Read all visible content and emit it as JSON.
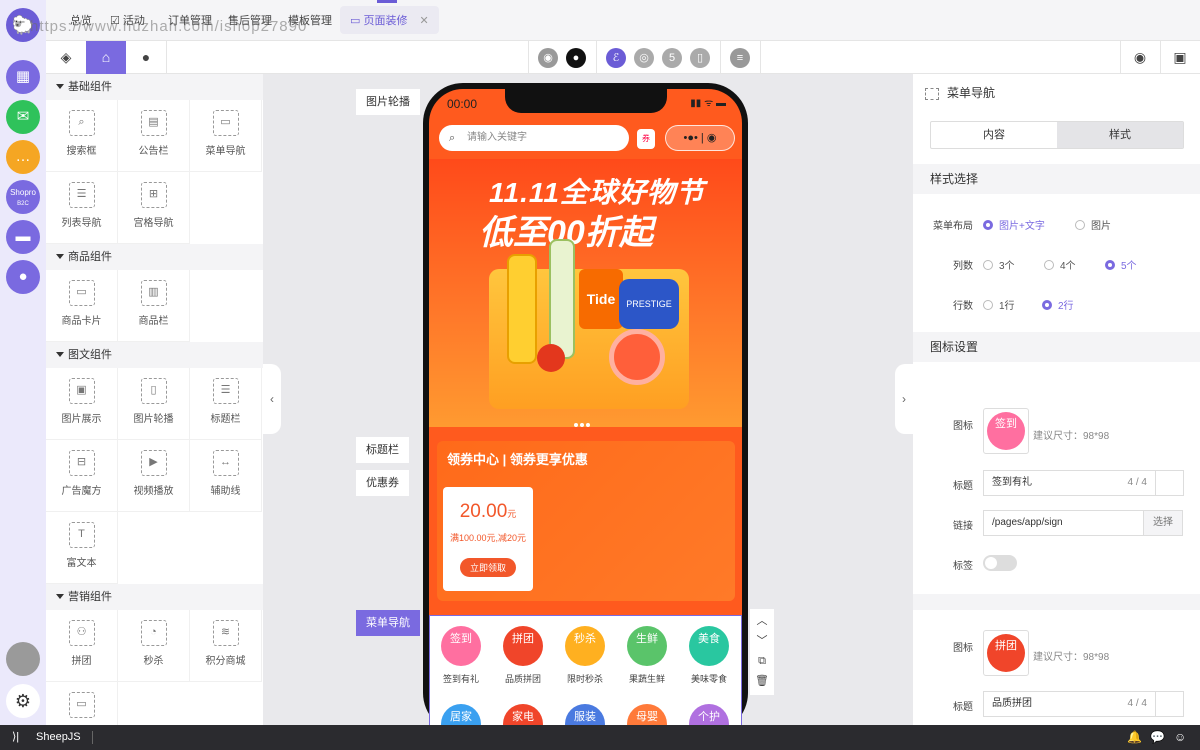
{
  "watermark": "https://www.huzhan.com/ishop27890",
  "topnav": {
    "tabs": [
      {
        "label": "总览"
      },
      {
        "label": "活动"
      },
      {
        "label": "订单管理"
      },
      {
        "label": "售后管理"
      },
      {
        "label": "模板管理"
      },
      {
        "label": "页面装修"
      }
    ],
    "close": "✕"
  },
  "rail": {
    "logo": "🐑",
    "items": [
      {
        "icon": "apps-icon",
        "glyph": "▦",
        "color": "#7a6ae0"
      },
      {
        "icon": "wechat-icon",
        "glyph": "✉",
        "color": "#2fc25b"
      },
      {
        "icon": "chat-icon",
        "glyph": "…",
        "color": "#f5a623"
      },
      {
        "icon": "shopro-icon",
        "glyph": "Shopro",
        "color": "#7a6ae0"
      },
      {
        "icon": "folder-icon",
        "glyph": "▬",
        "color": "#7a6ae0"
      },
      {
        "icon": "user-icon",
        "glyph": "●",
        "color": "#7a6ae0"
      }
    ],
    "shopro_sub": "B2C"
  },
  "left_panel": {
    "groups": [
      {
        "title": "基础组件",
        "items": [
          {
            "label": "搜索框",
            "glyph": "⌕"
          },
          {
            "label": "公告栏",
            "glyph": "▤"
          },
          {
            "label": "菜单导航",
            "glyph": "▭"
          },
          {
            "label": "列表导航",
            "glyph": "☰"
          },
          {
            "label": "宫格导航",
            "glyph": "⊞"
          }
        ]
      },
      {
        "title": "商品组件",
        "items": [
          {
            "label": "商品卡片",
            "glyph": "▭"
          },
          {
            "label": "商品栏",
            "glyph": "▥"
          }
        ]
      },
      {
        "title": "图文组件",
        "items": [
          {
            "label": "图片展示",
            "glyph": "▣"
          },
          {
            "label": "图片轮播",
            "glyph": "▯"
          },
          {
            "label": "标题栏",
            "glyph": "☰"
          },
          {
            "label": "广告魔方",
            "glyph": "⊟"
          },
          {
            "label": "视频播放",
            "glyph": "▶"
          },
          {
            "label": "辅助线",
            "glyph": "↔"
          },
          {
            "label": "富文本",
            "glyph": "T"
          }
        ]
      },
      {
        "title": "营销组件",
        "items": [
          {
            "label": "拼团",
            "glyph": "⚇"
          },
          {
            "label": "秒杀",
            "glyph": "◔"
          },
          {
            "label": "积分商城",
            "glyph": "≋"
          },
          {
            "label": "",
            "glyph": "▭"
          }
        ]
      }
    ]
  },
  "canvas_tags": {
    "banner": "图片轮播",
    "title": "标题栏",
    "coupon": "优惠券",
    "menu": "菜单导航"
  },
  "phone": {
    "time": "00:00",
    "status": "▮▮ ᯤ ▬",
    "search_placeholder": "请输入关键字",
    "coupon_icon": "券",
    "capsule": "•●•  |  ◉",
    "banner_line1": "11.11全球好物节",
    "banner_line2": "低至00折起",
    "tide": "Tide",
    "can": "PRESTIGE",
    "coupon_title": "领券中心 | 领券更享优惠",
    "coupon_amount": "20.00",
    "coupon_unit": "元",
    "coupon_rule": "满100.00元,减20元",
    "coupon_btn": "立即领取",
    "menu": [
      {
        "badge": "签到",
        "label": "签到有礼",
        "color": "#ff6fa0"
      },
      {
        "badge": "拼团",
        "label": "品质拼团",
        "color": "#f0452a"
      },
      {
        "badge": "秒杀",
        "label": "限时秒杀",
        "color": "#ffb020"
      },
      {
        "badge": "生鲜",
        "label": "果蔬生鲜",
        "color": "#5ac46a"
      },
      {
        "badge": "美食",
        "label": "美味零食",
        "color": "#29c7a0"
      }
    ],
    "menu_row2": [
      {
        "badge": "居家",
        "color": "#3aa0f0"
      },
      {
        "badge": "家电",
        "color": "#f0452a"
      },
      {
        "badge": "服装",
        "color": "#4a7ae0"
      },
      {
        "badge": "母婴",
        "color": "#ff7a3a"
      },
      {
        "badge": "个护",
        "color": "#b070e0"
      }
    ]
  },
  "right_panel": {
    "title": "菜单导航",
    "tabs": [
      "内容",
      "样式"
    ],
    "section_style": "样式选择",
    "layout_label": "菜单布局",
    "layout_options": [
      "图片+文字",
      "图片"
    ],
    "cols_label": "列数",
    "cols_options": [
      "3个",
      "4个",
      "5个"
    ],
    "rows_label": "行数",
    "rows_options": [
      "1行",
      "2行"
    ],
    "section_icons": "图标设置",
    "icon_label": "图标",
    "title_label": "标题",
    "link_label": "链接",
    "tag_label": "标签",
    "hint": "建议尺寸：98*98",
    "item1": {
      "badge": "签到",
      "title": "签到有礼",
      "count": "4 / 4",
      "link": "/pages/app/sign",
      "select": "选择"
    },
    "item2": {
      "badge": "拼团",
      "title": "品质拼团",
      "count": "4 / 4"
    }
  },
  "bottombar": {
    "prompt": "⟩|",
    "name": "SheepJS"
  },
  "colors": {
    "accent": "#7a6ae0",
    "orange": "#ff5a1e"
  }
}
